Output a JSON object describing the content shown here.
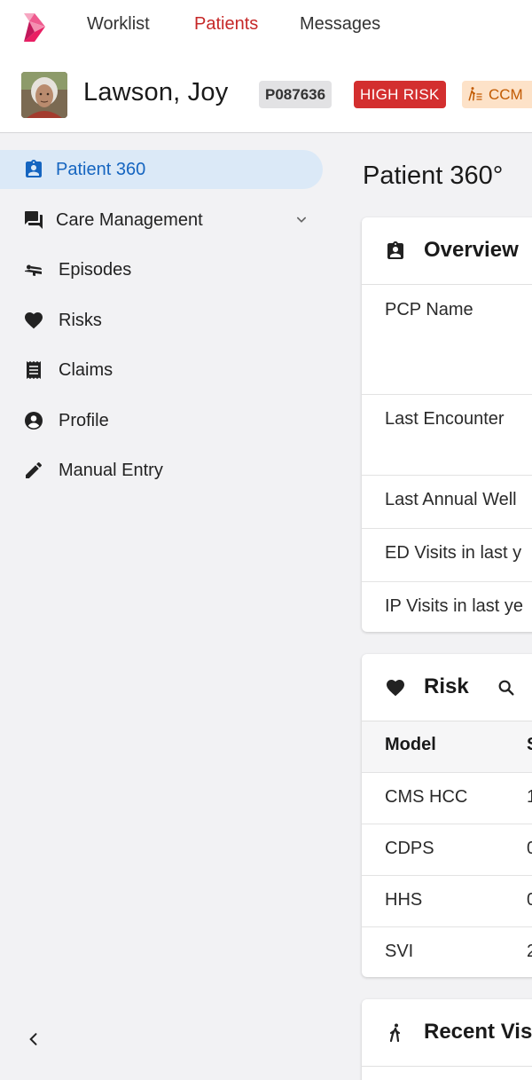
{
  "nav": {
    "items": [
      {
        "label": "Worklist",
        "active": false
      },
      {
        "label": "Patients",
        "active": true
      },
      {
        "label": "Messages",
        "active": false
      }
    ]
  },
  "patient": {
    "name": "Lawson, Joy",
    "id": "P087636",
    "risk_badge": "HIGH RISK",
    "program_badge": "CCM"
  },
  "sidebar": {
    "items": [
      {
        "label": "Patient 360",
        "icon": "badge-icon",
        "active": true
      },
      {
        "label": "Care Management",
        "icon": "chat-icon",
        "expandable": true
      },
      {
        "label": "Episodes",
        "icon": "bed-icon"
      },
      {
        "label": "Risks",
        "icon": "heart-icon"
      },
      {
        "label": "Claims",
        "icon": "receipt-icon"
      },
      {
        "label": "Profile",
        "icon": "account-circle-icon"
      },
      {
        "label": "Manual Entry",
        "icon": "pencil-icon"
      }
    ]
  },
  "main": {
    "title": "Patient 360°",
    "overview": {
      "title": "Overview",
      "rows": [
        {
          "label": "PCP Name"
        },
        {
          "label": "Last Encounter"
        },
        {
          "label": "Last Annual Well"
        },
        {
          "label": "ED Visits in last y"
        },
        {
          "label": "IP Visits in last ye"
        }
      ]
    },
    "risk": {
      "title": "Risk",
      "columns": [
        "Model",
        "S"
      ],
      "rows": [
        {
          "model": "CMS HCC",
          "value": "1"
        },
        {
          "model": "CDPS",
          "value": "0"
        },
        {
          "model": "HHS",
          "value": "0"
        },
        {
          "model": "SVI",
          "value": "2"
        }
      ]
    },
    "recent_visits": {
      "title": "Recent Vis"
    }
  },
  "colors": {
    "accent_red": "#c62828",
    "high_risk": "#d32f2f",
    "active_blue": "#1565c0",
    "active_bg": "#dbe9f7",
    "ccm_bg": "#fde2c8",
    "ccm_text": "#c25a00"
  }
}
